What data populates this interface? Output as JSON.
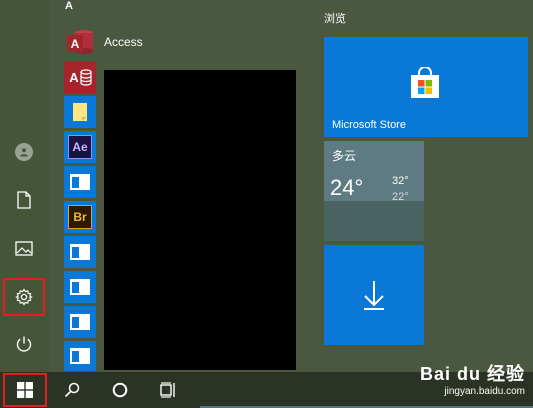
{
  "app_list": {
    "letter": "A",
    "items": [
      {
        "label": "Access",
        "icon": "access-icon",
        "color": "#a4262c"
      },
      {
        "label": "",
        "icon": "access-db-icon",
        "color": "#a4262c"
      },
      {
        "label": "",
        "icon": "note-icon",
        "color": "#0a78d7"
      },
      {
        "label": "",
        "icon": "after-effects-icon",
        "color": "#0a78d7"
      },
      {
        "label": "",
        "icon": "app-icon",
        "color": "#0a78d7"
      },
      {
        "label": "",
        "icon": "bridge-icon",
        "color": "#0a78d7"
      },
      {
        "label": "",
        "icon": "app-icon",
        "color": "#0a78d7"
      },
      {
        "label": "",
        "icon": "app-icon",
        "color": "#0a78d7"
      },
      {
        "label": "",
        "icon": "app-icon",
        "color": "#0a78d7"
      },
      {
        "label": "",
        "icon": "app-icon",
        "color": "#0a78d7"
      },
      {
        "label": "",
        "icon": "app-icon",
        "color": "#0a78d7"
      }
    ],
    "ae_text": "Ae",
    "br_text": "Br"
  },
  "tiles": {
    "group_title": "浏览",
    "store_label": "Microsoft Store",
    "weather": {
      "condition": "多云",
      "temp": "24°",
      "high": "32°",
      "low": "22°"
    }
  },
  "rail": {
    "items": [
      "user-icon",
      "document-icon",
      "pictures-icon",
      "settings-icon",
      "power-icon"
    ],
    "highlighted": "settings-icon"
  },
  "taskbar": {
    "items": [
      "windows-start-icon",
      "search-icon",
      "cortana-icon",
      "task-view-icon"
    ]
  },
  "watermark": {
    "logo": "Bai du 经验",
    "url": "jingyan.baidu.com"
  },
  "colors": {
    "accent": "#0a78d7",
    "highlight": "#e02020"
  }
}
